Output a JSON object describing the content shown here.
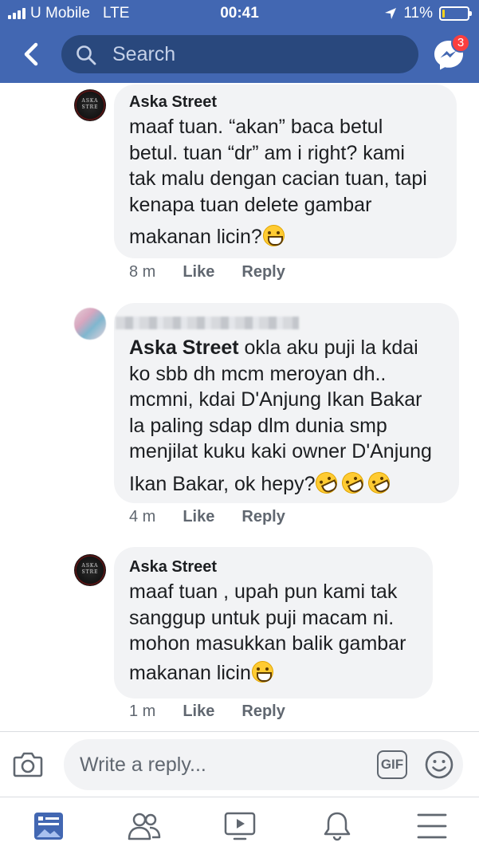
{
  "status_bar": {
    "carrier": "U Mobile",
    "network": "LTE",
    "time": "00:41",
    "battery_percent": "11%",
    "battery_level": 0.11
  },
  "header": {
    "search_placeholder": "Search",
    "messenger_badge": "3",
    "accent_color": "#4267b2"
  },
  "comments": [
    {
      "author": "Aska Street",
      "avatar_logo": "ASKA STREET",
      "lines": [
        "maaf tuan. “akan” baca betul",
        "betul. tuan “dr” am i right? kami",
        "tak malu dengan cacian tuan, tapi",
        "kenapa tuan delete gambar",
        "makanan licin?"
      ],
      "emojis": [
        "grinning-face"
      ],
      "time": "8 m",
      "like_label": "Like",
      "reply_label": "Reply"
    },
    {
      "author": "",
      "mention": "Aska Street",
      "lines": [
        " okla aku puji la kdai",
        "ko sbb dh mcm meroyan dh..",
        "mcmni, kdai D'Anjung Ikan Bakar",
        "la paling sdap dlm dunia smp",
        "menjilat kuku kaki owner D'Anjung",
        "Ikan Bakar, ok hepy?"
      ],
      "emojis": [
        "rofl-face",
        "rofl-face",
        "rofl-face"
      ],
      "time": "4 m",
      "like_label": "Like",
      "reply_label": "Reply"
    },
    {
      "author": "Aska Street",
      "avatar_logo": "ASKA STREET",
      "lines": [
        "maaf tuan , upah pun kami tak",
        "sanggup untuk puji macam ni.",
        "mohon masukkan balik gambar",
        "makanan licin"
      ],
      "emojis": [
        "grinning-face"
      ],
      "time": "1 m",
      "like_label": "Like",
      "reply_label": "Reply"
    }
  ],
  "composer": {
    "placeholder": "Write a reply...",
    "gif_label": "GIF"
  },
  "bottom_nav": [
    "news-feed-icon",
    "friends-icon",
    "watch-icon",
    "notifications-icon",
    "menu-icon"
  ]
}
